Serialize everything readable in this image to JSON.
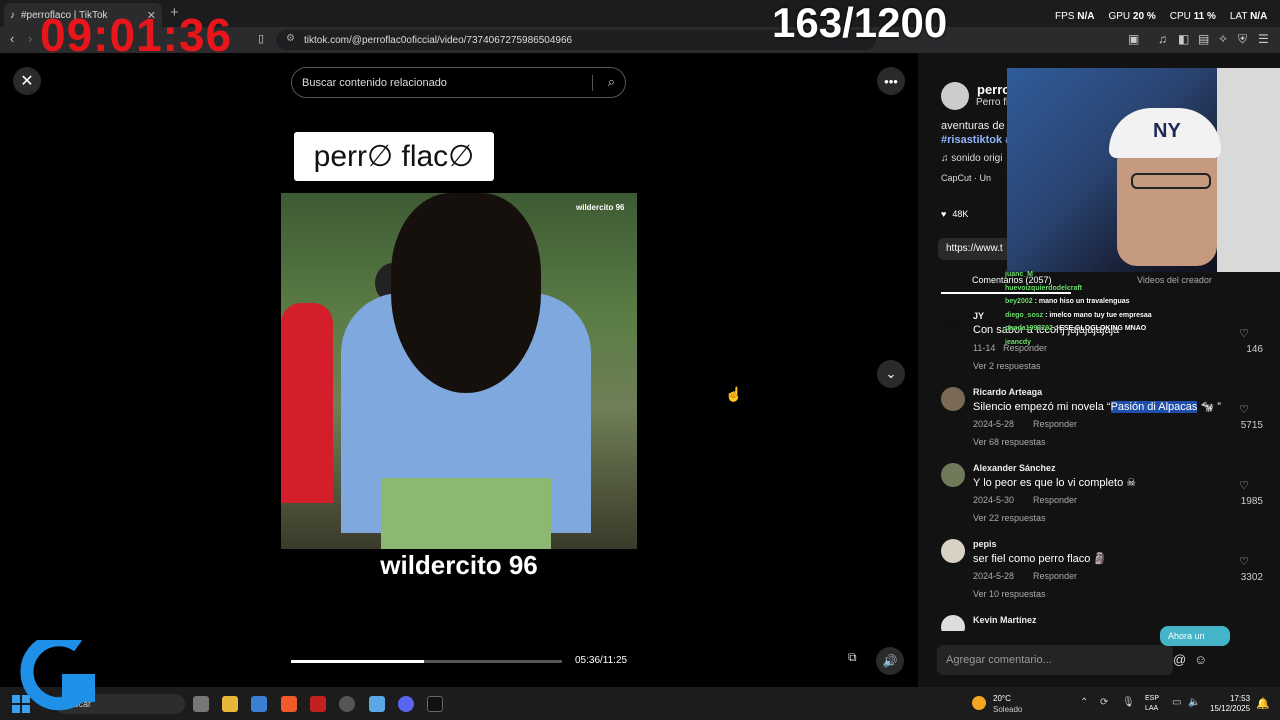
{
  "browser": {
    "tab_title": "#perroflaco | TikTok",
    "new_tab": "+",
    "url": "tiktok.com/@perroflac0oficcial/video/7374067275986504966"
  },
  "overlay": {
    "clock": "09:01:36",
    "counter": "163/1200",
    "stats": [
      {
        "label": "FPS",
        "value": "N/A"
      },
      {
        "label": "GPU",
        "value": "20 %"
      },
      {
        "label": "CPU",
        "value": "11 %"
      },
      {
        "label": "LAT",
        "value": "N/A"
      }
    ]
  },
  "player": {
    "search_placeholder": "Buscar contenido relacionado",
    "logo_text": "perr∅ flac∅",
    "watermark": "wildercito 96",
    "caption": "wildercito 96",
    "time": "05:36/11:25",
    "progress": 0.49
  },
  "panel": {
    "author_name": "perro",
    "author_sub": "Perro fl",
    "description": "aventuras de",
    "hashtags": "#risastiktok #",
    "music": "♫  sonido origi",
    "capcut": "CapCut · Un",
    "likes": "48K",
    "link": "https://www.t",
    "tabs": {
      "comments": "Comentarios (2057)",
      "creator": "Videos del creador"
    },
    "comments": [
      {
        "name": "JY",
        "text": "Con sabor a tccohj jajajajajaja",
        "date": "11-14",
        "reply": "Responder",
        "replies": "Ver 2 respuestas",
        "likes": "146"
      },
      {
        "name": "Ricardo Arteaga",
        "text_pre": "Silencio empezó mi novela “",
        "text_hl": "Pasión di Alpacas",
        "text_post": " 🐄 ”",
        "date": "2024-5-28",
        "reply": "Responder",
        "replies": "Ver 68 respuestas",
        "likes": "5715"
      },
      {
        "name": "Alexander Sánchez",
        "text": "Y lo peor es que lo vi completo ☠",
        "date": "2024-5-30",
        "reply": "Responder",
        "replies": "Ver 22 respuestas",
        "likes": "1985"
      },
      {
        "name": "pepis",
        "text": "ser fiel como perro flaco 🗿",
        "date": "2024-5-28",
        "reply": "Responder",
        "replies": "Ver 10 respuestas",
        "likes": "3302"
      },
      {
        "name": "Kevin Martínez",
        "text": "",
        "date": "",
        "reply": "",
        "replies": "",
        "likes": ""
      }
    ],
    "add_comment_placeholder": "Agregar comentario...",
    "ahora": "Ahora un"
  },
  "chat": [
    {
      "user": "juanc_M",
      "msg": ""
    },
    {
      "user": "huevoizquierdodelcraft",
      "msg": ""
    },
    {
      "user": "bey2002",
      "msg": "mano hiso un travalenguas"
    },
    {
      "user": "diego_sosz",
      "msg": "imelco mano tuy tue empresaa"
    },
    {
      "user": "panda1997202",
      "msg": "ESE GLOGLOKING MNAO"
    },
    {
      "user": "jeancdy",
      "msg": ""
    }
  ],
  "taskbar": {
    "search": "Buscar",
    "temp": "20°C",
    "weather": "Soleado",
    "lang1": "ESP",
    "lang2": "LAA",
    "time": "17:53",
    "date": "15/12/2025"
  }
}
